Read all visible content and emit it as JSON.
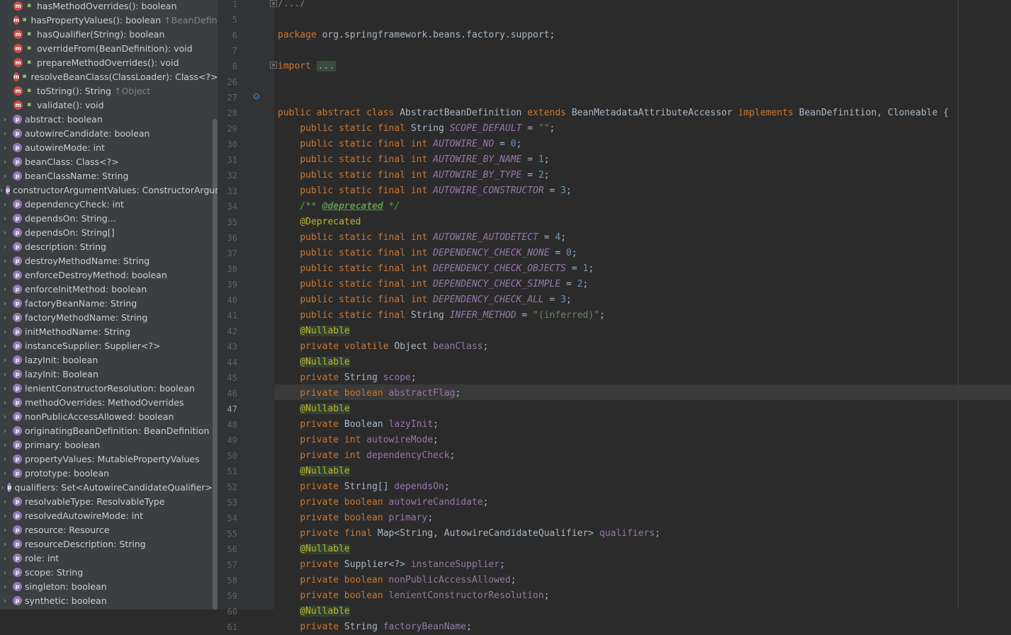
{
  "structure": {
    "rows": [
      {
        "kind": "method",
        "name": "hasMethodOverrides(): boolean",
        "extra": ""
      },
      {
        "kind": "method",
        "name": "hasPropertyValues(): boolean",
        "extra": "↑BeanDefinitio"
      },
      {
        "kind": "method",
        "name": "hasQualifier(String): boolean",
        "extra": ""
      },
      {
        "kind": "method",
        "name": "overrideFrom(BeanDefinition): void",
        "extra": ""
      },
      {
        "kind": "method",
        "name": "prepareMethodOverrides(): void",
        "extra": ""
      },
      {
        "kind": "method",
        "name": "resolveBeanClass(ClassLoader): Class<?>",
        "extra": ""
      },
      {
        "kind": "method",
        "name": "toString(): String",
        "extra": "↑Object"
      },
      {
        "kind": "method",
        "name": "validate(): void",
        "extra": ""
      },
      {
        "kind": "property",
        "name": "abstract: boolean",
        "extra": ""
      },
      {
        "kind": "property",
        "name": "autowireCandidate: boolean",
        "extra": ""
      },
      {
        "kind": "property",
        "name": "autowireMode: int",
        "extra": ""
      },
      {
        "kind": "property",
        "name": "beanClass: Class<?>",
        "extra": ""
      },
      {
        "kind": "property",
        "name": "beanClassName: String",
        "extra": ""
      },
      {
        "kind": "property",
        "name": "constructorArgumentValues: ConstructorArgum",
        "extra": ""
      },
      {
        "kind": "property",
        "name": "dependencyCheck: int",
        "extra": ""
      },
      {
        "kind": "property",
        "name": "dependsOn: String...",
        "extra": ""
      },
      {
        "kind": "property",
        "name": "dependsOn: String[]",
        "extra": ""
      },
      {
        "kind": "property",
        "name": "description: String",
        "extra": ""
      },
      {
        "kind": "property",
        "name": "destroyMethodName: String",
        "extra": ""
      },
      {
        "kind": "property",
        "name": "enforceDestroyMethod: boolean",
        "extra": ""
      },
      {
        "kind": "property",
        "name": "enforceInitMethod: boolean",
        "extra": ""
      },
      {
        "kind": "property",
        "name": "factoryBeanName: String",
        "extra": ""
      },
      {
        "kind": "property",
        "name": "factoryMethodName: String",
        "extra": ""
      },
      {
        "kind": "property",
        "name": "initMethodName: String",
        "extra": ""
      },
      {
        "kind": "property",
        "name": "instanceSupplier: Supplier<?>",
        "extra": ""
      },
      {
        "kind": "property",
        "name": "lazyInit: boolean",
        "extra": ""
      },
      {
        "kind": "property",
        "name": "lazyInit: Boolean",
        "extra": ""
      },
      {
        "kind": "property",
        "name": "lenientConstructorResolution: boolean",
        "extra": ""
      },
      {
        "kind": "property",
        "name": "methodOverrides: MethodOverrides",
        "extra": ""
      },
      {
        "kind": "property",
        "name": "nonPublicAccessAllowed: boolean",
        "extra": ""
      },
      {
        "kind": "property",
        "name": "originatingBeanDefinition: BeanDefinition",
        "extra": ""
      },
      {
        "kind": "property",
        "name": "primary: boolean",
        "extra": ""
      },
      {
        "kind": "property",
        "name": "propertyValues: MutablePropertyValues",
        "extra": ""
      },
      {
        "kind": "property",
        "name": "prototype: boolean",
        "extra": ""
      },
      {
        "kind": "property",
        "name": "qualifiers: Set<AutowireCandidateQualifier>",
        "extra": ""
      },
      {
        "kind": "property",
        "name": "resolvableType: ResolvableType",
        "extra": ""
      },
      {
        "kind": "property",
        "name": "resolvedAutowireMode: int",
        "extra": ""
      },
      {
        "kind": "property",
        "name": "resource: Resource",
        "extra": ""
      },
      {
        "kind": "property",
        "name": "resourceDescription: String",
        "extra": ""
      },
      {
        "kind": "property",
        "name": "role: int",
        "extra": ""
      },
      {
        "kind": "property",
        "name": "scope: String",
        "extra": ""
      },
      {
        "kind": "property",
        "name": "singleton: boolean",
        "extra": ""
      },
      {
        "kind": "property",
        "name": "synthetic: boolean",
        "extra": ""
      }
    ],
    "method_icon_letter": "m",
    "property_icon_letter": "p"
  },
  "editor": {
    "current_line": "47",
    "lines": [
      {
        "no": "1",
        "html": "<span class=\"fold\">/.../</span>"
      },
      {
        "no": "5",
        "html": ""
      },
      {
        "no": "6",
        "html": "<span class=\"kw\">package</span> org.springframework.beans.factory.support;"
      },
      {
        "no": "7",
        "html": ""
      },
      {
        "no": "8",
        "html": "<span class=\"kw\">import</span> <span class=\"folded\">...</span>"
      },
      {
        "no": "26",
        "html": ""
      },
      {
        "no": "27",
        "html": ""
      },
      {
        "no": "28",
        "html": "<span class=\"kw\">public abstract class</span> AbstractBeanDefinition <span class=\"kw\">extends</span> BeanMetadataAttributeAccessor <span class=\"kw\">implements</span> BeanDefinition, Cloneable {"
      },
      {
        "no": "29",
        "html": "    <span class=\"kw\">public static final</span> String <span class=\"const\">SCOPE_DEFAULT</span> = <span class=\"str\">\"\"</span>;"
      },
      {
        "no": "30",
        "html": "    <span class=\"kw\">public static final int</span> <span class=\"const\">AUTOWIRE_NO</span> = <span class=\"num\">0</span>;"
      },
      {
        "no": "31",
        "html": "    <span class=\"kw\">public static final int</span> <span class=\"const\">AUTOWIRE_BY_NAME</span> = <span class=\"num\">1</span>;"
      },
      {
        "no": "32",
        "html": "    <span class=\"kw\">public static final int</span> <span class=\"const\">AUTOWIRE_BY_TYPE</span> = <span class=\"num\">2</span>;"
      },
      {
        "no": "33",
        "html": "    <span class=\"kw\">public static final int</span> <span class=\"const\">AUTOWIRE_CONSTRUCTOR</span> = <span class=\"num\">3</span>;"
      },
      {
        "no": "34",
        "html": "    <span class=\"comment\">/** <span class=\"doctag\">@deprecated</span> */</span>"
      },
      {
        "no": "35",
        "html": "    <span class=\"anno\">@Deprecated</span>"
      },
      {
        "no": "36",
        "html": "    <span class=\"kw\">public static final int</span> <span class=\"const\">AUTOWIRE_AUTODETECT</span> = <span class=\"num\">4</span>;"
      },
      {
        "no": "37",
        "html": "    <span class=\"kw\">public static final int</span> <span class=\"const\">DEPENDENCY_CHECK_NONE</span> = <span class=\"num\">0</span>;"
      },
      {
        "no": "38",
        "html": "    <span class=\"kw\">public static final int</span> <span class=\"const\">DEPENDENCY_CHECK_OBJECTS</span> = <span class=\"num\">1</span>;"
      },
      {
        "no": "39",
        "html": "    <span class=\"kw\">public static final int</span> <span class=\"const\">DEPENDENCY_CHECK_SIMPLE</span> = <span class=\"num\">2</span>;"
      },
      {
        "no": "40",
        "html": "    <span class=\"kw\">public static final int</span> <span class=\"const\">DEPENDENCY_CHECK_ALL</span> = <span class=\"num\">3</span>;"
      },
      {
        "no": "41",
        "html": "    <span class=\"kw\">public static final</span> String <span class=\"const\">INFER_METHOD</span> = <span class=\"str\">\"(inferred)\"</span>;"
      },
      {
        "no": "42",
        "html": "    <span class=\"anno-hl\">@Nullable</span>"
      },
      {
        "no": "43",
        "html": "    <span class=\"kw\">private volatile</span> Object <span class=\"field\">beanClass</span>;"
      },
      {
        "no": "44",
        "html": "    <span class=\"anno-hl\">@Nullable</span>"
      },
      {
        "no": "45",
        "html": "    <span class=\"kw\">private</span> String <span class=\"field\">scope</span>;"
      },
      {
        "no": "46",
        "html": "    <span class=\"kw\">private boolean</span> <span class=\"field\">abstractFlag</span>;"
      },
      {
        "no": "47",
        "html": "    <span class=\"anno-hl\">@Nullable</span>"
      },
      {
        "no": "48",
        "html": "    <span class=\"kw\">private</span> Boolean <span class=\"field\">lazyInit</span>;"
      },
      {
        "no": "49",
        "html": "    <span class=\"kw\">private int</span> <span class=\"field\">autowireMode</span>;"
      },
      {
        "no": "50",
        "html": "    <span class=\"kw\">private int</span> <span class=\"field\">dependencyCheck</span>;"
      },
      {
        "no": "51",
        "html": "    <span class=\"anno-hl\">@Nullable</span>"
      },
      {
        "no": "52",
        "html": "    <span class=\"kw\">private</span> String[] <span class=\"field\">dependsOn</span>;"
      },
      {
        "no": "53",
        "html": "    <span class=\"kw\">private boolean</span> <span class=\"field\">autowireCandidate</span>;"
      },
      {
        "no": "54",
        "html": "    <span class=\"kw\">private boolean</span> <span class=\"field\">primary</span>;"
      },
      {
        "no": "55",
        "html": "    <span class=\"kw\">private final</span> Map&lt;String, AutowireCandidateQualifier&gt; <span class=\"field\">qualifiers</span>;"
      },
      {
        "no": "56",
        "html": "    <span class=\"anno-hl\">@Nullable</span>"
      },
      {
        "no": "57",
        "html": "    <span class=\"kw\">private</span> Supplier&lt;?&gt; <span class=\"field\">instanceSupplier</span>;"
      },
      {
        "no": "58",
        "html": "    <span class=\"kw\">private boolean</span> <span class=\"field\">nonPublicAccessAllowed</span>;"
      },
      {
        "no": "59",
        "html": "    <span class=\"kw\">private boolean</span> <span class=\"field\">lenientConstructorResolution</span>;"
      },
      {
        "no": "60",
        "html": "    <span class=\"anno-hl\">@Nullable</span>"
      },
      {
        "no": "61",
        "html": "    <span class=\"kw\">private</span> String <span class=\"field\">factoryBeanName</span>;"
      }
    ]
  },
  "colors": {
    "keyword": "#cc7832",
    "constant": "#9876aa",
    "number": "#6897bb",
    "string": "#6a8759",
    "annotation": "#bbb529",
    "comment": "#629755"
  }
}
